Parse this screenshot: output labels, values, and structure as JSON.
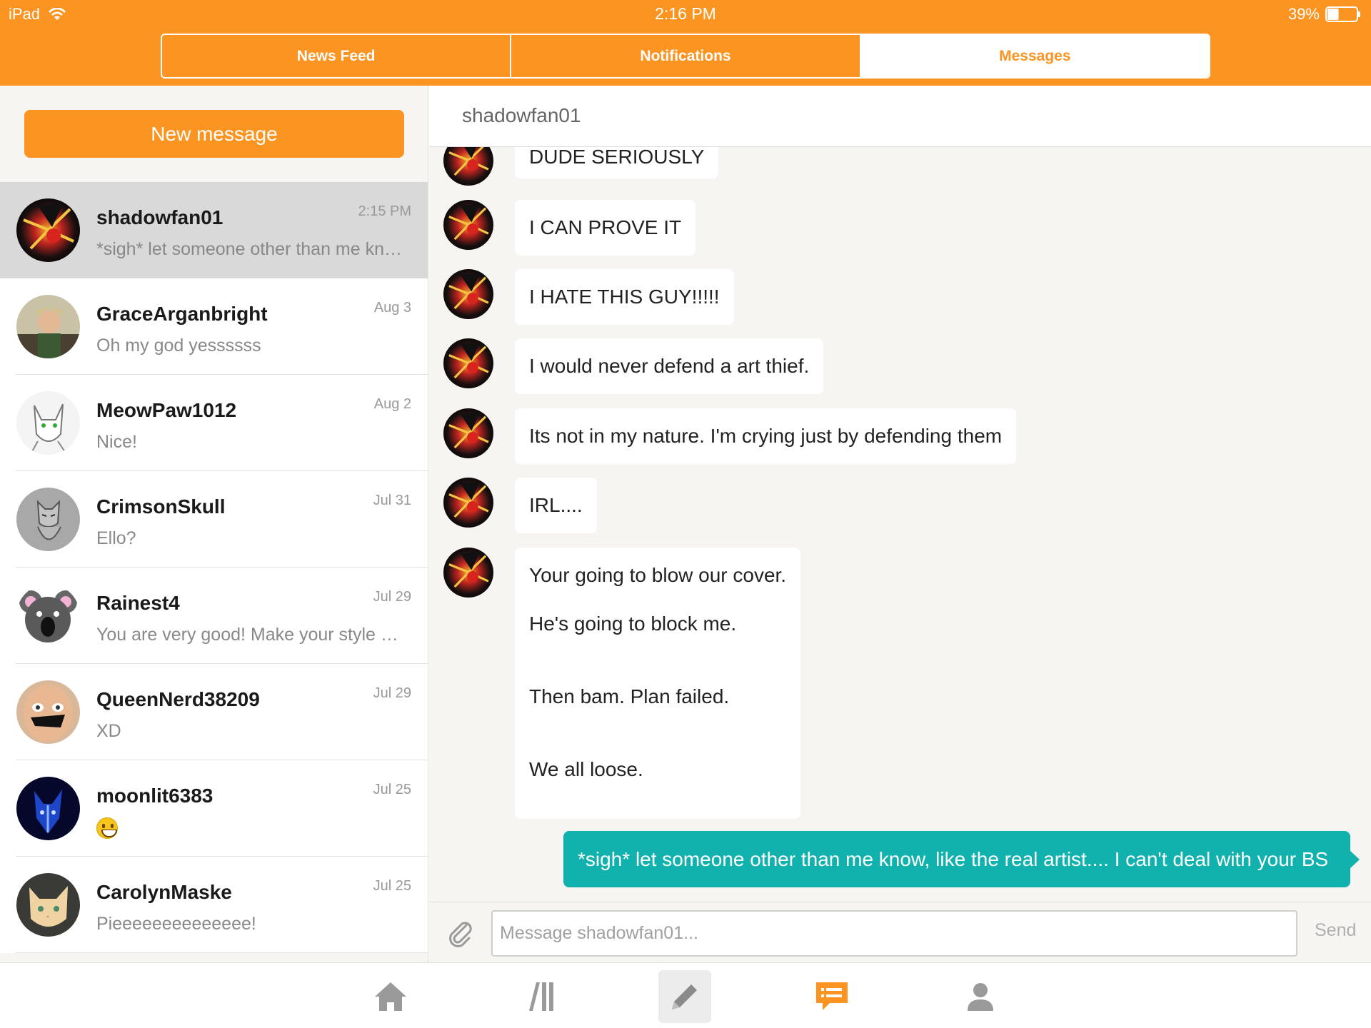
{
  "status_bar": {
    "device": "iPad",
    "time": "2:16 PM",
    "battery": "39%",
    "battery_level": 0.39
  },
  "top_tabs": [
    {
      "label": "News Feed",
      "active": false
    },
    {
      "label": "Notifications",
      "active": false
    },
    {
      "label": "Messages",
      "active": true
    }
  ],
  "sidebar": {
    "new_message_label": "New message",
    "conversations": [
      {
        "name": "shadowfan01",
        "date": "2:15 PM",
        "preview": "*sigh* let someone other than me know, like the real artist.... I can't deal with your BS",
        "selected": true,
        "avatar": "shadow-hedgehog-avatar"
      },
      {
        "name": "GraceArganbright",
        "date": "Aug 3",
        "preview": "Oh my god yessssss",
        "selected": false,
        "avatar": "person-avatar"
      },
      {
        "name": "MeowPaw1012",
        "date": "Aug 2",
        "preview": "Nice!",
        "selected": false,
        "avatar": "white-cat-sketch-avatar"
      },
      {
        "name": "CrimsonSkull",
        "date": "Jul 31",
        "preview": "Ello?",
        "selected": false,
        "avatar": "tiger-sketch-avatar"
      },
      {
        "name": "Rainest4",
        "date": "Jul 29",
        "preview": "You are very good! Make your style more unique",
        "selected": false,
        "avatar": "koala-avatar"
      },
      {
        "name": "QueenNerd38209",
        "date": "Jul 29",
        "preview": "XD",
        "selected": false,
        "avatar": "face-photo-avatar"
      },
      {
        "name": "moonlit6383",
        "date": "Jul 25",
        "preview": "",
        "preview_emoji": "grinning-face-emoji",
        "selected": false,
        "avatar": "blue-wolf-avatar"
      },
      {
        "name": "CarolynMaske",
        "date": "Jul 25",
        "preview": "Pieeeeeeeeeeeeee!",
        "selected": false,
        "avatar": "cat-photo-avatar"
      }
    ]
  },
  "chat": {
    "title": "shadowfan01",
    "incoming": [
      {
        "lines": [
          "DUDE SERIOUSLY"
        ]
      },
      {
        "lines": [
          "I CAN PROVE IT"
        ]
      },
      {
        "lines": [
          "I HATE THIS GUY!!!!!"
        ]
      },
      {
        "lines": [
          "I would never defend a art thief."
        ]
      },
      {
        "lines": [
          "Its not in my nature. I'm crying just by defending them"
        ]
      },
      {
        "lines": [
          "IRL...."
        ]
      },
      {
        "lines": [
          "Your going to blow our cover.",
          "",
          "He's going to block me.",
          "",
          "",
          "Then bam. Plan failed.",
          "",
          "",
          "We all loose."
        ]
      }
    ],
    "outgoing": "*sigh* let someone other than me know, like the real artist.... I can't deal with your BS",
    "composer": {
      "placeholder": "Message shadowfan01...",
      "send_label": "Send",
      "attach_icon": "paperclip-icon"
    }
  },
  "bottom_bar": [
    {
      "icon": "home-icon",
      "active": false
    },
    {
      "icon": "browse-icon",
      "active": false
    },
    {
      "icon": "pencil-icon",
      "active": false,
      "highlighted": true
    },
    {
      "icon": "messages-icon",
      "active": true
    },
    {
      "icon": "profile-icon",
      "active": false
    }
  ],
  "colors": {
    "brand_orange": "#fb9420",
    "outgoing_teal": "#11b1ad",
    "panel_bg": "#f6f5f2"
  }
}
